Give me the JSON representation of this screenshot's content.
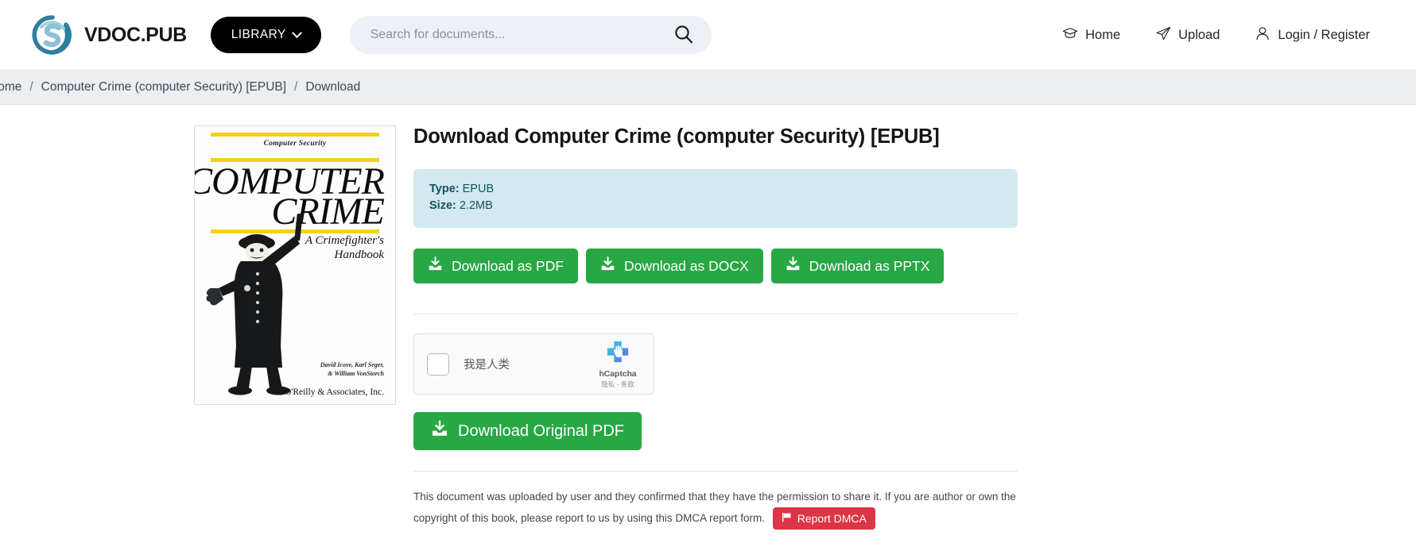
{
  "header": {
    "brand_name": "VDOC.PUB",
    "logo_icon": "circle-s-logo-icon",
    "library_label": "LIBRARY",
    "library_chevron_icon": "chevron-down-icon",
    "search": {
      "placeholder": "Search for documents...",
      "value": "",
      "icon": "search-icon"
    },
    "nav": [
      {
        "label": "Home",
        "icon": "graduation-cap-icon"
      },
      {
        "label": "Upload",
        "icon": "paper-plane-icon"
      },
      {
        "label": "Login / Register",
        "icon": "user-icon"
      }
    ]
  },
  "breadcrumb": {
    "items": [
      "Home",
      "Computer Crime (computer Security) [EPUB]",
      "Download"
    ],
    "separator": "/"
  },
  "cover": {
    "series": "Computer Security",
    "title_line1": "COMPUTER",
    "title_line2": "CRIME",
    "subtitle_line1": "A Crimefighter's",
    "subtitle_line2": "Handbook",
    "authors_line1": "David Icove, Karl Seger,",
    "authors_line2": "& William VonStorch",
    "publisher": "O'Reilly & Associates, Inc.",
    "accent_color": "#f5cf24"
  },
  "main": {
    "page_title": "Download Computer Crime (computer Security) [EPUB]",
    "info": {
      "type_label": "Type:",
      "type_value": "EPUB",
      "size_label": "Size:",
      "size_value": "2.2MB",
      "bg_color": "#d3e9ef",
      "text_color": "#0f5460"
    },
    "download_buttons": [
      {
        "label": "Download as PDF",
        "icon": "download-icon"
      },
      {
        "label": "Download as DOCX",
        "icon": "download-icon"
      },
      {
        "label": "Download as PPTX",
        "icon": "download-icon"
      }
    ],
    "button_color": "#28a745",
    "captcha": {
      "checkbox_label": "我是人类",
      "brand_name": "hCaptcha",
      "links": "隐私 - 条款",
      "logo_icon": "hcaptcha-hand-icon",
      "checked": false
    },
    "original_button": {
      "label": "Download Original PDF",
      "icon": "download-icon"
    },
    "disclaimer": {
      "text": "This document was uploaded by user and they confirmed that they have the permission to share it. If you are author or own the copyright of this book, please report to us by using this DMCA report form.",
      "dmca_button_label": "Report DMCA",
      "dmca_button_icon": "flag-icon",
      "dmca_color": "#dc3545"
    }
  }
}
